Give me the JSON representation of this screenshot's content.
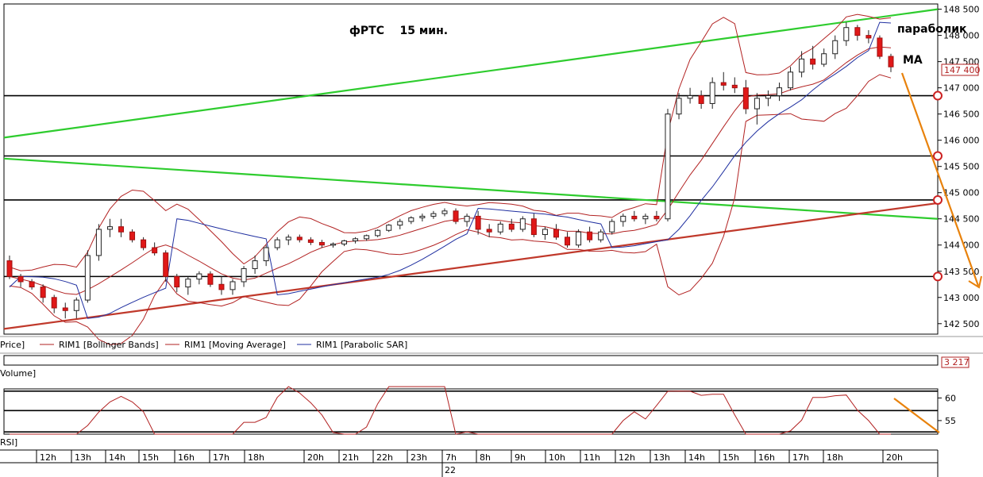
{
  "chart_data": {
    "type": "candlestick",
    "title": "фРТС    15 мин.",
    "annotations": {
      "parabolic": "параболик",
      "ma": "MA"
    },
    "y_ticks": [
      "148 500",
      "148 000",
      "147 500",
      "147 000",
      "146 500",
      "146 000",
      "145 500",
      "145 000",
      "144 500",
      "144 000",
      "143 500",
      "143 000",
      "142 500"
    ],
    "ylim": [
      142300,
      148600
    ],
    "last_price": "147 400",
    "horizontal_levels": [
      146850,
      145700,
      144860,
      143400
    ],
    "trendlines": [
      {
        "color": "#2ecc2e",
        "from": [
          0,
          146050
        ],
        "to": [
          1.0,
          148500
        ]
      },
      {
        "color": "#2ecc2e",
        "from": [
          0,
          145650
        ],
        "to": [
          1.0,
          144500
        ]
      },
      {
        "color": "#c0392b",
        "from": [
          0,
          142400
        ],
        "to": [
          1.0,
          144800
        ]
      }
    ],
    "candles": [
      [
        143700,
        143800,
        143350,
        143400
      ],
      [
        143400,
        143450,
        143200,
        143300
      ],
      [
        143300,
        143350,
        143150,
        143200
      ],
      [
        143200,
        143250,
        142900,
        143000
      ],
      [
        143000,
        143050,
        142700,
        142800
      ],
      [
        142800,
        142900,
        142600,
        142750
      ],
      [
        142750,
        143000,
        142600,
        142950
      ],
      [
        142950,
        143900,
        142900,
        143800
      ],
      [
        143800,
        144400,
        143700,
        144300
      ],
      [
        144300,
        144500,
        144150,
        144350
      ],
      [
        144350,
        144500,
        144150,
        144250
      ],
      [
        144250,
        144300,
        144050,
        144100
      ],
      [
        144100,
        144150,
        143900,
        143950
      ],
      [
        143950,
        144050,
        143800,
        143850
      ],
      [
        143850,
        143900,
        143300,
        143400
      ],
      [
        143400,
        143450,
        143100,
        143200
      ],
      [
        143200,
        143400,
        143050,
        143350
      ],
      [
        143350,
        143500,
        143250,
        143450
      ],
      [
        143450,
        143500,
        143200,
        143250
      ],
      [
        143250,
        143400,
        143050,
        143150
      ],
      [
        143150,
        143350,
        143050,
        143300
      ],
      [
        143300,
        143600,
        143200,
        143550
      ],
      [
        143550,
        143800,
        143450,
        143700
      ],
      [
        143700,
        144000,
        143600,
        143950
      ],
      [
        143950,
        144150,
        143900,
        144100
      ],
      [
        144100,
        144200,
        144000,
        144150
      ],
      [
        144150,
        144200,
        144050,
        144100
      ],
      [
        144100,
        144150,
        144000,
        144050
      ],
      [
        144050,
        144100,
        143950,
        144000
      ],
      [
        144000,
        144050,
        143950,
        144020
      ],
      [
        144020,
        144100,
        143980,
        144080
      ],
      [
        144080,
        144150,
        144030,
        144120
      ],
      [
        144120,
        144200,
        144080,
        144180
      ],
      [
        144180,
        144300,
        144150,
        144280
      ],
      [
        144280,
        144400,
        144250,
        144380
      ],
      [
        144380,
        144500,
        144300,
        144450
      ],
      [
        144450,
        144550,
        144400,
        144520
      ],
      [
        144520,
        144600,
        144450,
        144550
      ],
      [
        144550,
        144650,
        144500,
        144600
      ],
      [
        144600,
        144700,
        144550,
        144650
      ],
      [
        144650,
        144700,
        144400,
        144450
      ],
      [
        144450,
        144600,
        144350,
        144550
      ],
      [
        144550,
        144650,
        144200,
        144300
      ],
      [
        144300,
        144400,
        144150,
        144250
      ],
      [
        144250,
        144450,
        144200,
        144400
      ],
      [
        144400,
        144500,
        144250,
        144300
      ],
      [
        144300,
        144550,
        144250,
        144500
      ],
      [
        144500,
        144600,
        144150,
        144200
      ],
      [
        144200,
        144350,
        144100,
        144300
      ],
      [
        144300,
        144400,
        144100,
        144150
      ],
      [
        144150,
        144250,
        143950,
        144000
      ],
      [
        144000,
        144300,
        143950,
        144250
      ],
      [
        144250,
        144350,
        144050,
        144100
      ],
      [
        144100,
        144300,
        144050,
        144250
      ],
      [
        144250,
        144500,
        144200,
        144450
      ],
      [
        144450,
        144600,
        144350,
        144550
      ],
      [
        144550,
        144650,
        144450,
        144500
      ],
      [
        144500,
        144600,
        144400,
        144550
      ],
      [
        144550,
        144650,
        144450,
        144500
      ],
      [
        144500,
        146600,
        144450,
        146500
      ],
      [
        146500,
        146900,
        146400,
        146800
      ],
      [
        146800,
        147000,
        146700,
        146850
      ],
      [
        146850,
        146950,
        146600,
        146700
      ],
      [
        146700,
        147200,
        146600,
        147100
      ],
      [
        147100,
        147300,
        146950,
        147050
      ],
      [
        147050,
        147200,
        146900,
        147000
      ],
      [
        147000,
        147150,
        146500,
        146600
      ],
      [
        146600,
        146900,
        146300,
        146800
      ],
      [
        146800,
        146950,
        146650,
        146850
      ],
      [
        146850,
        147100,
        146750,
        147000
      ],
      [
        147000,
        147400,
        146950,
        147300
      ],
      [
        147300,
        147700,
        147200,
        147550
      ],
      [
        147550,
        147800,
        147350,
        147450
      ],
      [
        147450,
        147750,
        147400,
        147650
      ],
      [
        147650,
        148000,
        147550,
        147900
      ],
      [
        147900,
        148250,
        147800,
        148150
      ],
      [
        148150,
        148200,
        147900,
        148000
      ],
      [
        148000,
        148100,
        147850,
        147950
      ],
      [
        147950,
        148000,
        147550,
        147600
      ],
      [
        147600,
        147650,
        147300,
        147400
      ]
    ],
    "series": [
      {
        "name": "RIM1 [Bollinger Bands]",
        "color": "#b22222"
      },
      {
        "name": "RIM1 [Moving Average]",
        "color": "#b22222"
      },
      {
        "name": "RIM1 [Parabolic SAR]",
        "color": "#1f2fa0"
      }
    ],
    "volume_label": "Volume]",
    "volume_value": "3 217",
    "price_label": "Price]",
    "rsi_label": "RSI]",
    "rsi_ticks": [
      "60",
      "55"
    ],
    "rsi_levels": [
      61.5,
      57.2,
      52.5
    ],
    "rsi_ylim": [
      52,
      62
    ],
    "x_labels": [
      "12h",
      "13h",
      "14h",
      "15h",
      "16h",
      "17h",
      "18h",
      "20h",
      "21h",
      "22h",
      "23h",
      "7h",
      "8h",
      "9h",
      "10h",
      "11h",
      "12h",
      "13h",
      "14h",
      "15h",
      "16h",
      "17h",
      "18h",
      "20h"
    ],
    "date_label": "22"
  }
}
